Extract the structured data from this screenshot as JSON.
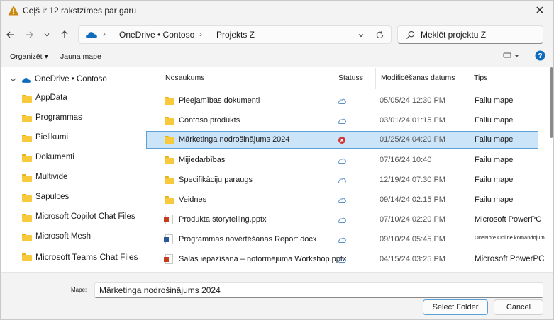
{
  "window": {
    "title": "Ceļš ir 12 rakstzīmes par garu",
    "colors": {
      "accent": "#0067c0",
      "selection": "#cce4f7",
      "error": "#d13438",
      "warning": "#e8a317",
      "folder": "#f9c93c"
    }
  },
  "navigation": {
    "back_icon": "arrow-left-icon",
    "forward_icon": "arrow-right-icon",
    "recent_icon": "chevron-down-icon",
    "up_icon": "arrow-up-icon",
    "breadcrumbs": [
      "OneDrive • Contoso",
      "Projekts Z"
    ],
    "refresh_icon": "refresh-icon"
  },
  "search": {
    "placeholder": "Meklēt projektu Z"
  },
  "toolbar": {
    "organize": "Organizēt",
    "new_folder": "Jauna mape",
    "view_icon": "view-icon",
    "help_icon": "help-icon"
  },
  "tree": {
    "root": "OneDrive • Contoso",
    "items": [
      "AppData",
      "Programmas",
      "Pielikumi",
      "Dokumenti",
      "Multivide",
      "Sapulces",
      "Microsoft Copilot Chat Files",
      "Microsoft Mesh",
      "Microsoft Teams Chat Files"
    ]
  },
  "columns": {
    "name": "Nosaukums",
    "status": "Statuss",
    "modified": "Modificēšanas datums",
    "type": "Tips"
  },
  "files": [
    {
      "name": "Pieejamības dokumenti",
      "status": "cloud",
      "date": "05/05/24 12:30 PM",
      "type": "Failu mape",
      "kind": "folder"
    },
    {
      "name": "Contoso produkts",
      "status": "cloud",
      "date": "03/01/24 01:15 PM",
      "type": "Failu mape",
      "kind": "folder"
    },
    {
      "name": "Mārketinga nodrošinājums 2024",
      "status": "error",
      "date": "01/25/24 04:20 PM",
      "type": "Failu mape",
      "kind": "folder",
      "selected": true
    },
    {
      "name": "Mijiedarbības",
      "status": "cloud",
      "date": "07/16/24 10:40",
      "type": "Failu mape",
      "kind": "folder"
    },
    {
      "name": "Specifikāciju paraugs",
      "status": "cloud",
      "date": "12/19/24 07:30 PM",
      "type": "Failu mape",
      "kind": "folder"
    },
    {
      "name": "Veidnes",
      "status": "cloud",
      "date": "09/14/24 02:15 PM",
      "type": "Failu mape",
      "kind": "folder"
    },
    {
      "name": "Produkta storytelling.pptx",
      "status": "cloud",
      "date": "07/10/24 02:20 PM",
      "type": "Microsoft PowerPC",
      "kind": "ppt"
    },
    {
      "name": "Programmas novērtēšanas Report.docx",
      "status": "cloud",
      "date": "09/10/24 05:45 PM",
      "type": "OneNote Online komandojumi",
      "kind": "doc",
      "small_type": true
    },
    {
      "name": "Salas iepazīšana – noformējuma Workshop.pptx",
      "status": "cloud",
      "date": "04/15/24 03:25 PM",
      "type": "Microsoft PowerPC",
      "kind": "ppt"
    }
  ],
  "footer": {
    "filename_label": "Mape:",
    "filename_value": "Mārketinga nodrošinājums 2024",
    "select_button": "Select Folder",
    "cancel_button": "Cancel"
  }
}
